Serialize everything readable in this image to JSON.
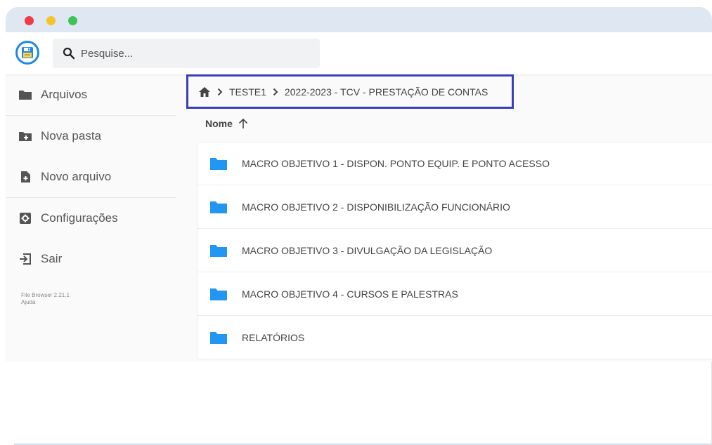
{
  "search": {
    "placeholder": "Pesquise..."
  },
  "sidebar": {
    "items": [
      {
        "label": "Arquivos",
        "icon": "folder-icon"
      },
      {
        "label": "Nova pasta",
        "icon": "new-folder-icon"
      },
      {
        "label": "Novo arquivo",
        "icon": "new-file-icon"
      },
      {
        "label": "Configurações",
        "icon": "settings-icon"
      },
      {
        "label": "Sair",
        "icon": "logout-icon"
      }
    ],
    "credits": {
      "version": "File Browser 2.21.1",
      "help": "Ajuda"
    }
  },
  "breadcrumb": {
    "items": [
      "TESTE1",
      "2022-2023 - TCV - PRESTAÇÃO DE CONTAS"
    ]
  },
  "list": {
    "sort_label": "Nome",
    "rows": [
      "MACRO OBJETIVO 1 - DISPON. PONTO EQUIP. E PONTO ACESSO",
      "MACRO OBJETIVO 2 - DISPONIBILIZAÇÃO FUNCIONÁRIO",
      "MACRO OBJETIVO 3 - DIVULGAÇÃO DA LEGISLAÇÃO",
      "MACRO OBJETIVO 4 - CURSOS E PALESTRAS",
      "RELATÓRIOS"
    ]
  },
  "colors": {
    "accent": "#1e88e5",
    "folder": "#2196f3",
    "highlight_border": "#3a3fb6"
  }
}
